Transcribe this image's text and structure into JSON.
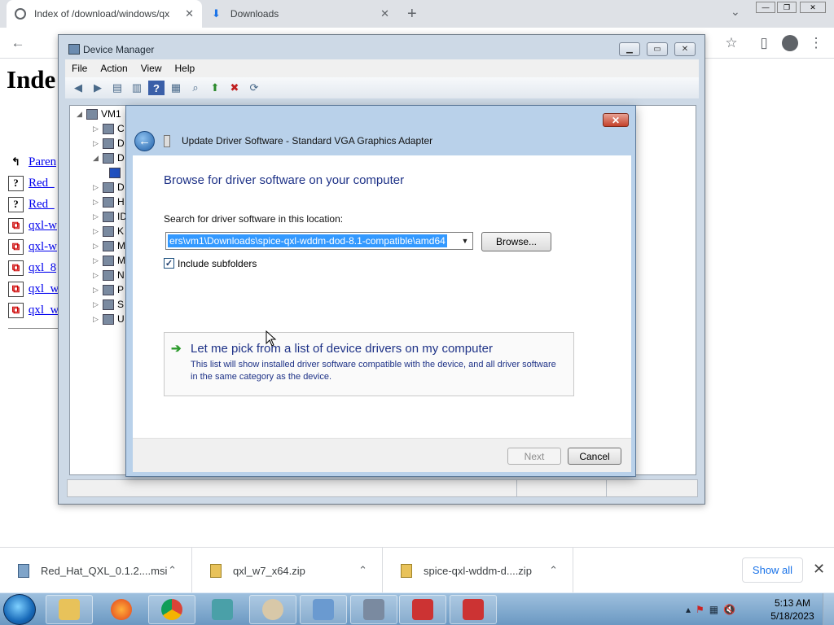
{
  "browser": {
    "tabs": [
      {
        "title": "Index of /download/windows/qx",
        "active": true,
        "icon": "globe-icon"
      },
      {
        "title": "Downloads",
        "active": false,
        "icon": "download-icon"
      }
    ],
    "new_tab": "+",
    "tab_menu": "⌄",
    "window_min": "—",
    "window_max": "❐",
    "window_close": "✕"
  },
  "page": {
    "heading": "Inde",
    "files": [
      "Paren",
      "Red_",
      "Red_",
      "qxl-w",
      "qxl-w",
      "qxl_8",
      "qxl_w",
      "qxl_w"
    ]
  },
  "device_manager": {
    "title": "Device Manager",
    "menu": [
      "File",
      "Action",
      "View",
      "Help"
    ],
    "tree_root": "VM1",
    "tree_items": [
      "C",
      "D",
      "D",
      "",
      "D",
      "H",
      "ID",
      "K",
      "M",
      "M",
      "N",
      "P",
      "S",
      "U"
    ]
  },
  "wizard": {
    "close": "✕",
    "title": "Update Driver Software - Standard VGA Graphics Adapter",
    "heading": "Browse for driver software on your computer",
    "location_label": "Search for driver software in this location:",
    "path_value": "ers\\vm1\\Downloads\\spice-qxl-wddm-dod-8.1-compatible\\amd64",
    "browse": "Browse...",
    "include_subfolders": "Include subfolders",
    "include_subfolders_checked": true,
    "pick_title": "Let me pick from a list of device drivers on my computer",
    "pick_desc": "This list will show installed driver software compatible with the device, and all driver software in the same category as the device.",
    "next": "Next",
    "cancel": "Cancel"
  },
  "downloads": {
    "items": [
      "Red_Hat_QXL_0.1.2....msi",
      "qxl_w7_x64.zip",
      "spice-qxl-wddm-d....zip"
    ],
    "show_all": "Show all",
    "close": "✕"
  },
  "taskbar": {
    "time": "5:13 AM",
    "date": "5/18/2023"
  }
}
